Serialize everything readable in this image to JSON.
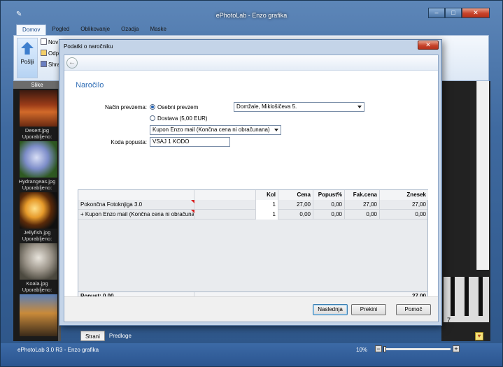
{
  "app": {
    "title": "ePhotoLab - Enzo grafika",
    "tabs": [
      "Domov",
      "Pogled",
      "Oblikovanje",
      "Ozadja",
      "Maske"
    ],
    "ribbon": {
      "big_button": "Pošlji",
      "small_items": [
        "Nov",
        "Odp",
        "Shra"
      ]
    },
    "left_panel": {
      "header": "Slike",
      "thumbnails": [
        {
          "name": "Desert.jpg",
          "status": "Uporabljeno:"
        },
        {
          "name": "Hydrangeas.jpg",
          "status": "Uporabljeno:"
        },
        {
          "name": "Jellyfish.jpg",
          "status": "Uporabljeno:"
        },
        {
          "name": "Koala.jpg",
          "status": "Uporabljeno:"
        }
      ]
    },
    "film_number": "7",
    "bottom_tabs": [
      "Strani",
      "Predloge"
    ],
    "status": {
      "text": "ePhotoLab 3.0 R3 - Enzo grafika",
      "zoom": "10%",
      "zoom_minus": "−",
      "zoom_plus": "+"
    },
    "window_buttons": {
      "minimize": "–",
      "maximize": "□",
      "close": "✕"
    }
  },
  "dialog": {
    "title": "Podatki o naročniku",
    "heading": "Naročilo",
    "fields": {
      "nacin_label": "Način prevzema:",
      "osebni_label": "Osebni prevzem",
      "osebni_selected": true,
      "location_value": "Domžale, Miklošičeva 5.",
      "dostava_label": "Dostava (5,00 EUR)",
      "dostava_selected": false,
      "coupon_value": "Kupon Enzo mail (Končna cena ni obračunana)",
      "koda_label": "Koda popusta:",
      "koda_value": "VSAJ 1 KODO"
    },
    "table": {
      "headers": [
        "",
        "",
        "Kol",
        "Cena",
        "Popust%",
        "Fak.cena",
        "Znesek"
      ],
      "rows": [
        [
          "Pokončna Fotoknjiga 3.0",
          "",
          "1",
          "27,00",
          "0,00",
          "27,00",
          "27,00"
        ],
        [
          "+ Kupon Enzo mail (Končna cena ni obračunana)",
          "",
          "1",
          "0,00",
          "0,00",
          "0,00",
          "0,00"
        ]
      ],
      "footer_label": "Popust: 0,00",
      "footer_total": "27,00"
    },
    "buttons": {
      "next": "Naslednja",
      "cancel": "Prekini",
      "help": "Pomoč"
    },
    "close_label": "✕"
  }
}
